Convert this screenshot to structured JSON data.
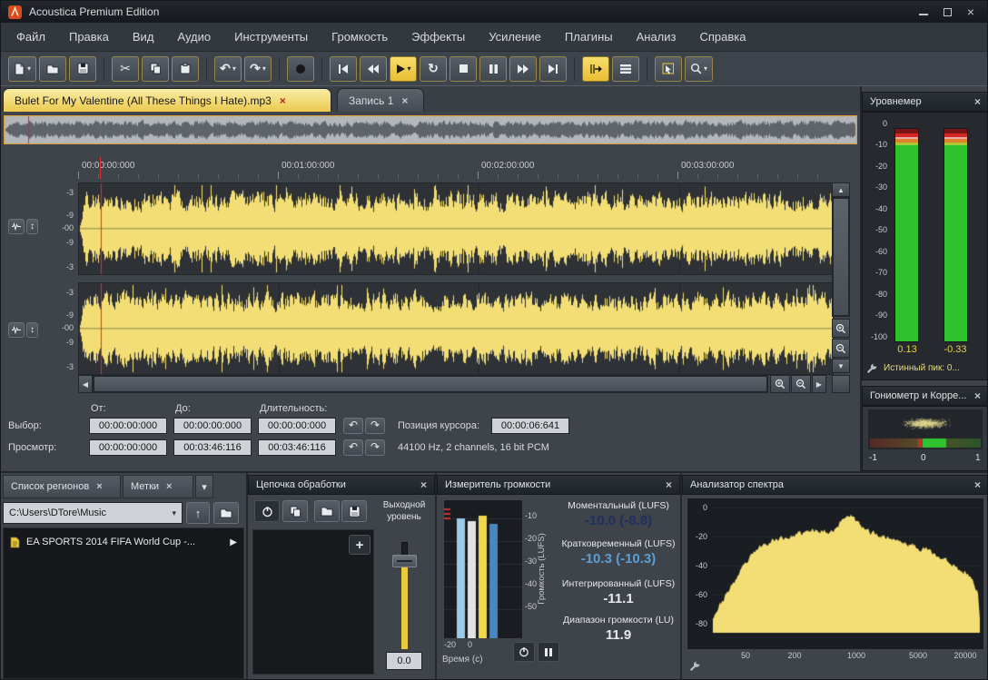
{
  "icons": {
    "cut": "✂",
    "undo": "↶",
    "redo": "↷",
    "loop": "↻",
    "up_arrow": "↑",
    "updown": "↕",
    "tri_up": "▲",
    "tri_down": "▼",
    "tri_left": "◀",
    "tri_right": "▶",
    "play_item": "▶",
    "plus": "+",
    "close": "×",
    "dropdown": "▾",
    "minimize": "─"
  },
  "window": {
    "title": "Acoustica Premium Edition"
  },
  "menu": {
    "items": [
      "Файл",
      "Правка",
      "Вид",
      "Аудио",
      "Инструменты",
      "Громкость",
      "Эффекты",
      "Усиление",
      "Плагины",
      "Анализ",
      "Справка"
    ]
  },
  "tabs": {
    "doc1": "Bulet For My Valentine (All These Things I Hate).mp3",
    "doc2": "Запись 1"
  },
  "ruler": {
    "ticks": [
      "00:00:00:000",
      "00:01:00:000",
      "00:02:00:000",
      "00:03:00:000"
    ]
  },
  "waveform": {
    "db_labels": [
      "-3",
      "-9",
      "-00",
      "-9",
      "-3"
    ]
  },
  "info": {
    "from_label": "От:",
    "to_label": "До:",
    "duration_label": "Длительность:",
    "selection_label": "Выбор:",
    "view_label": "Просмотр:",
    "selection": {
      "from": "00:00:00:000",
      "to": "00:00:00:000",
      "duration": "00:00:00:000"
    },
    "view": {
      "from": "00:00:00:000",
      "to": "00:03:46:116",
      "duration": "00:03:46:116"
    },
    "cursor_label": "Позиция курсора:",
    "cursor_value": "00:00:06:641",
    "format": "44100 Hz, 2 channels, 16 bit PCM"
  },
  "level_meter": {
    "title": "Уровнемер",
    "scale": [
      "0",
      "-10",
      "-20",
      "-30",
      "-40",
      "-50",
      "-60",
      "-70",
      "-80",
      "-90",
      "-100"
    ],
    "peak_left": "0.13",
    "peak_right": "-0.33",
    "true_peak_label": "Истинный пик: 0..."
  },
  "goniometer": {
    "title": "Гониометр и Корре...",
    "scale": [
      "-1",
      "0",
      "1"
    ]
  },
  "regions": {
    "tab_regions": "Список регионов",
    "tab_markers": "Метки",
    "path": "C:\\Users\\DTore\\Music",
    "items": [
      {
        "name": "EA SPORTS 2014 FIFA World Cup -..."
      }
    ]
  },
  "chain": {
    "title": "Цепочка обработки",
    "output_label": "Выходной уровень",
    "output_value": "0.0"
  },
  "loudness": {
    "title": "Измеритель громкости",
    "rows": [
      {
        "label": "Моментальный (LUFS)",
        "value": "-10.0 (-8.8)"
      },
      {
        "label": "Кратковременный (LUFS)",
        "value": "-10.3 (-10.3)"
      },
      {
        "label": "Интегрированный (LUFS)",
        "value": "-11.1"
      },
      {
        "label": "Диапазон громкости (LU)",
        "value": "11.9"
      }
    ],
    "ylabel": "Громкость (LUFS)",
    "yticks": [
      "-10",
      "-20",
      "-30",
      "-40",
      "-50"
    ],
    "xticks": [
      "-20",
      "0"
    ],
    "xlabel": "Время (с)"
  },
  "spectrum": {
    "title": "Анализатор спектра",
    "yticks": [
      "0",
      "-20",
      "-40",
      "-60",
      "-80"
    ],
    "xticks": [
      "50",
      "200",
      "1000",
      "5000",
      "20000"
    ],
    "envelope": [
      [
        20,
        -75
      ],
      [
        40,
        -45
      ],
      [
        60,
        -30
      ],
      [
        80,
        -24
      ],
      [
        100,
        -22
      ],
      [
        150,
        -20
      ],
      [
        200,
        -18
      ],
      [
        300,
        -15
      ],
      [
        400,
        -17
      ],
      [
        500,
        -13
      ],
      [
        600,
        -7
      ],
      [
        700,
        -4
      ],
      [
        800,
        -9
      ],
      [
        1000,
        -15
      ],
      [
        1500,
        -19
      ],
      [
        2000,
        -21
      ],
      [
        3000,
        -25
      ],
      [
        5000,
        -29
      ],
      [
        8000,
        -36
      ],
      [
        12000,
        -42
      ],
      [
        16000,
        -48
      ],
      [
        19000,
        -58
      ],
      [
        20000,
        -76
      ]
    ]
  },
  "colors": {
    "accent": "#f0c83c",
    "waveform": "#f2de74",
    "meter_green": "#2ec22e",
    "cursor": "#e03030"
  }
}
